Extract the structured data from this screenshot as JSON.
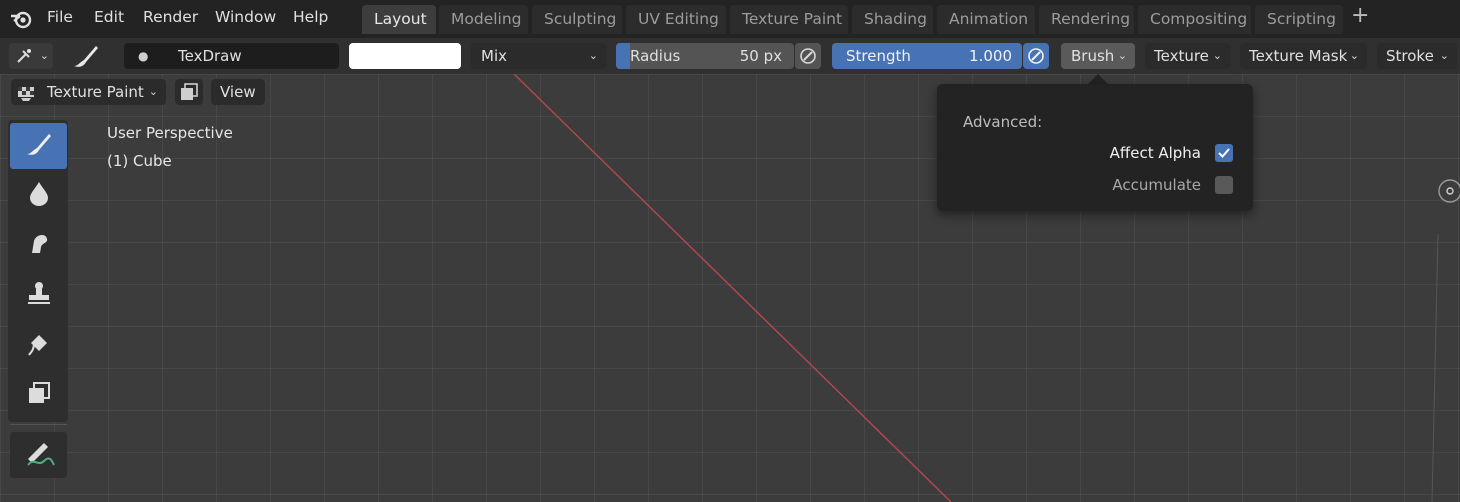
{
  "menu": {
    "items": [
      "File",
      "Edit",
      "Render",
      "Window",
      "Help"
    ]
  },
  "workspaces": {
    "tabs": [
      "Layout",
      "Modeling",
      "Sculpting",
      "UV Editing",
      "Texture Paint",
      "Shading",
      "Animation",
      "Rendering",
      "Compositing",
      "Scripting"
    ],
    "active": "Layout",
    "add_label": "+"
  },
  "tool_header": {
    "brush_name": "TexDraw",
    "color_swatch": "#ffffff",
    "blend_mode": "Mix",
    "radius": {
      "label": "Radius",
      "value": "50 px"
    },
    "strength": {
      "label": "Strength",
      "value": "1.000",
      "fraction": 1.0
    },
    "popovers": [
      "Brush",
      "Texture",
      "Texture Mask",
      "Stroke"
    ]
  },
  "mode_header": {
    "mode": "Texture Paint",
    "view_label": "View"
  },
  "viewport": {
    "perspective_label": "User Perspective",
    "object_label": "(1) Cube"
  },
  "brush_popover": {
    "section_label": "Advanced:",
    "options": [
      {
        "label": "Affect Alpha",
        "checked": true
      },
      {
        "label": "Accumulate",
        "checked": false
      }
    ]
  },
  "toolbar": {
    "tools": [
      "draw-brush-icon",
      "soften-icon",
      "smear-icon",
      "clone-icon",
      "fill-icon",
      "mask-icon",
      "annotate-icon"
    ],
    "active_tool": "draw-brush-icon"
  },
  "colors": {
    "accent": "#4772b3",
    "x_axis": "#b3484f"
  }
}
